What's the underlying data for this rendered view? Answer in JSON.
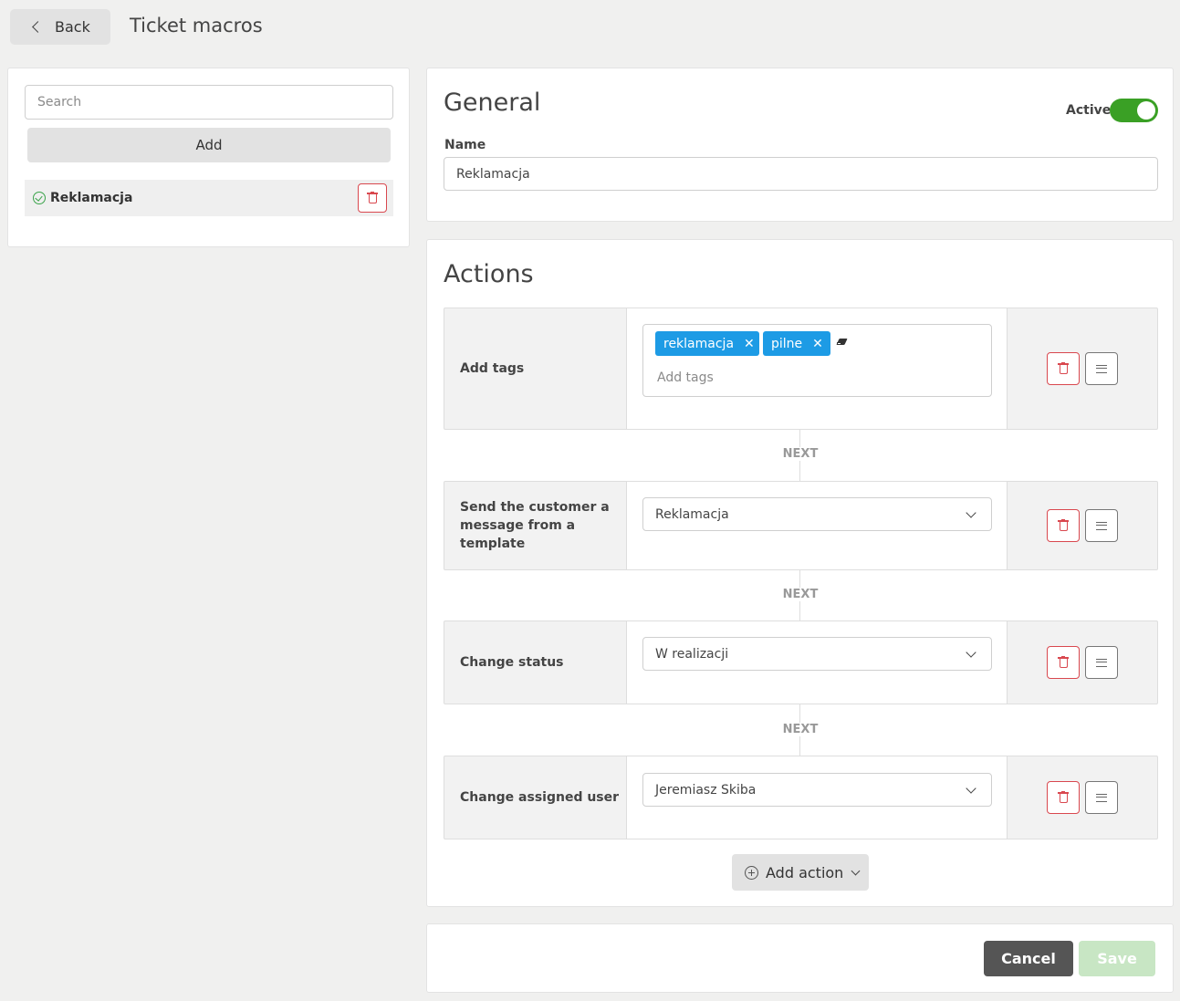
{
  "header": {
    "back_label": "Back",
    "title": "Ticket macros"
  },
  "sidebar": {
    "search_placeholder": "Search",
    "add_label": "Add",
    "macros": [
      {
        "label": "Reklamacja",
        "active": true
      }
    ]
  },
  "general": {
    "title": "General",
    "active_label": "Active",
    "active": true,
    "name_label": "Name",
    "name_value": "Reklamacja"
  },
  "actions": {
    "title": "Actions",
    "next_label": "NEXT",
    "items": [
      {
        "label": "Add tags",
        "tags": [
          "reklamacja",
          "pilne"
        ],
        "placeholder": "Add tags"
      },
      {
        "label": "Send the customer a message from a template",
        "value": "Reklamacja"
      },
      {
        "label": "Change status",
        "value": "W realizacji"
      },
      {
        "label": "Change assigned user",
        "value": "Jeremiasz Skiba"
      }
    ],
    "add_action_label": "Add action"
  },
  "footer": {
    "cancel_label": "Cancel",
    "save_label": "Save"
  },
  "colors": {
    "active_green": "#3aa025",
    "tag_blue": "#1d9be5",
    "danger_red": "#d9484f",
    "save_disabled": "#c8e6c4"
  }
}
